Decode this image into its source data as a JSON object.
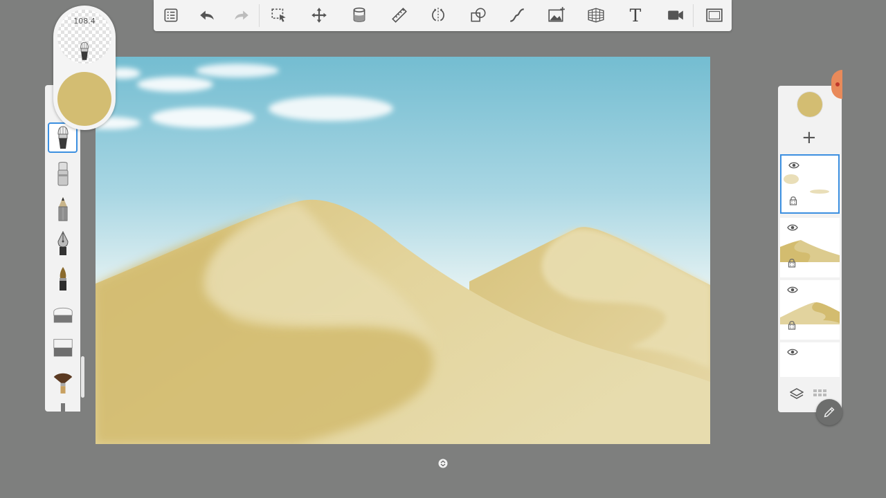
{
  "toolbar": {
    "tools": [
      {
        "id": "menu",
        "icon": "list-icon"
      },
      {
        "id": "undo",
        "icon": "undo-arrow-icon"
      },
      {
        "id": "redo",
        "icon": "redo-arrow-icon"
      },
      {
        "id": "selection",
        "icon": "selection-icon"
      },
      {
        "id": "transform",
        "icon": "move-icon"
      },
      {
        "id": "fill",
        "icon": "bucket-icon"
      },
      {
        "id": "ruler",
        "icon": "ruler-icon"
      },
      {
        "id": "symmetry",
        "icon": "symmetry-icon"
      },
      {
        "id": "shapes",
        "icon": "shapes-icon"
      },
      {
        "id": "stroke",
        "icon": "curve-icon"
      },
      {
        "id": "add-image",
        "icon": "image-icon"
      },
      {
        "id": "perspective",
        "icon": "perspective-grid-icon"
      },
      {
        "id": "text",
        "icon": "text-icon"
      },
      {
        "id": "record",
        "icon": "video-icon"
      },
      {
        "id": "fullscreen",
        "icon": "fullscreen-icon"
      }
    ],
    "text_glyph": "T"
  },
  "brush_puck": {
    "size_value": "108.4",
    "current_color": "#d3bd72"
  },
  "brush_library": {
    "selected": "airbrush",
    "brushes": [
      "airbrush",
      "marker",
      "pencil",
      "pen",
      "ink-brush",
      "hard-eraser",
      "soft-eraser",
      "fan-brush",
      "more"
    ]
  },
  "layers_panel": {
    "current_color": "#d3bd72",
    "add_symbol": "+",
    "layers": [
      {
        "id": "clouds",
        "visible": true,
        "selected": true
      },
      {
        "id": "dune-front",
        "visible": true,
        "selected": false
      },
      {
        "id": "dune-back",
        "visible": true,
        "selected": false
      },
      {
        "id": "background",
        "visible": true,
        "selected": false
      }
    ]
  },
  "colors": {
    "accent": "#3b8fe0",
    "sand": "#d3bd72",
    "sky": "#74bdd1",
    "ui_background": "#7e7f7e",
    "panel": "#f2f2f2"
  }
}
